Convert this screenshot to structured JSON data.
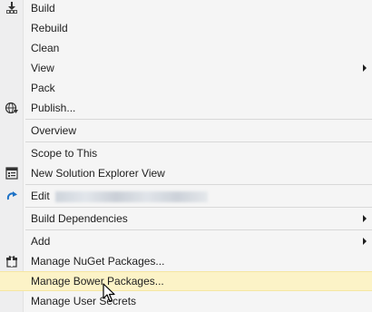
{
  "menu": {
    "items": {
      "build": "Build",
      "rebuild": "Rebuild",
      "clean": "Clean",
      "view": "View",
      "pack": "Pack",
      "publish": "Publish...",
      "overview": "Overview",
      "scope_to_this": "Scope to This",
      "new_solution_explorer_view": "New Solution Explorer View",
      "edit": "Edit",
      "build_dependencies": "Build Dependencies",
      "add": "Add",
      "manage_nuget": "Manage NuGet Packages...",
      "manage_bower": "Manage Bower Packages...",
      "manage_user_secrets": "Manage User Secrets"
    },
    "highlighted_item": "Manage Bower Packages..."
  },
  "colors": {
    "menu_background": "#f5f5f5",
    "gutter": "#eeeeef",
    "highlight": "#fcf3c7",
    "separator": "#d8d8d8",
    "text": "#1e1e1e",
    "edit_icon_accent": "#1e72c6"
  },
  "icons": {
    "build": "build-download-icon",
    "publish": "globe-publish-icon",
    "new_solution_explorer_view": "solution-explorer-window-icon",
    "edit": "edit-redo-arrow-icon",
    "manage_nuget": "nuget-package-icon"
  }
}
